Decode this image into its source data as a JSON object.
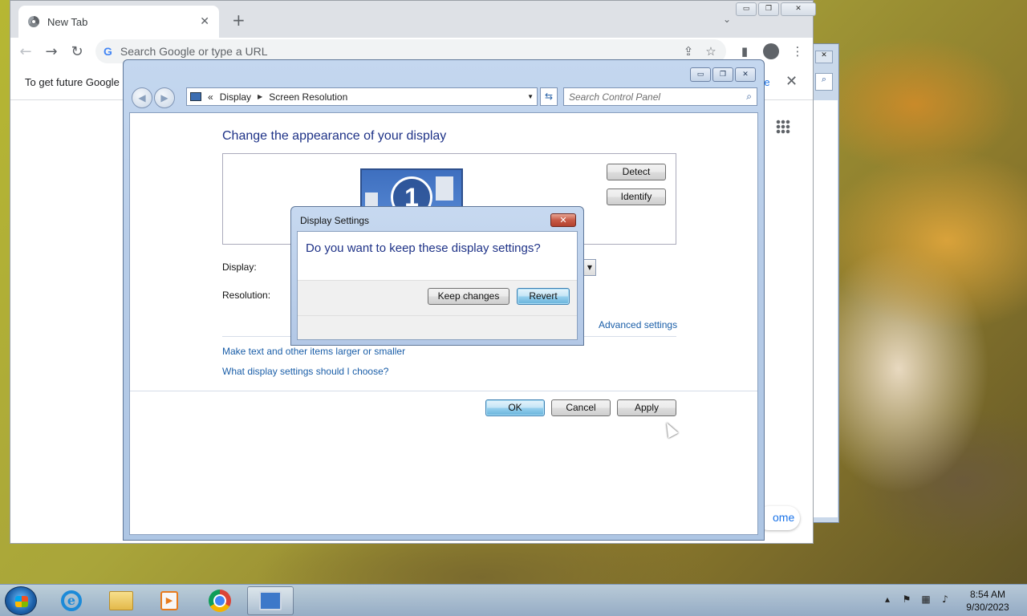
{
  "chrome": {
    "tab_title": "New Tab",
    "omnibox_placeholder": "Search Google or type a URL",
    "infobar_text": "To get future Google",
    "infobar_more": "re",
    "home_link": "ome"
  },
  "control_panel": {
    "breadcrumb": [
      "Display",
      "Screen Resolution"
    ],
    "breadcrumb_prefix": "«",
    "search_placeholder": "Search Control Panel",
    "heading": "Change the appearance of your display",
    "monitor_number": "1",
    "detect_label": "Detect",
    "identify_label": "Identify",
    "display_label": "Display:",
    "resolution_label": "Resolution:",
    "advanced_link": "Advanced settings",
    "link_text_size": "Make text and other items larger or smaller",
    "link_what_settings": "What display settings should I choose?",
    "ok_label": "OK",
    "cancel_label": "Cancel",
    "apply_label": "Apply"
  },
  "dialog": {
    "title": "Display Settings",
    "question": "Do you want to keep these display settings?",
    "keep_label": "Keep changes",
    "revert_label": "Revert"
  },
  "taskbar": {
    "time": "8:54 AM",
    "date": "9/30/2023",
    "items": [
      "internet-explorer",
      "windows-explorer",
      "media-player",
      "google-chrome",
      "control-panel"
    ],
    "active_item": "control-panel"
  },
  "colors": {
    "heading_blue": "#1e3287",
    "link_blue": "#1a5ea8",
    "chrome_tabstrip": "#dee1e6"
  }
}
